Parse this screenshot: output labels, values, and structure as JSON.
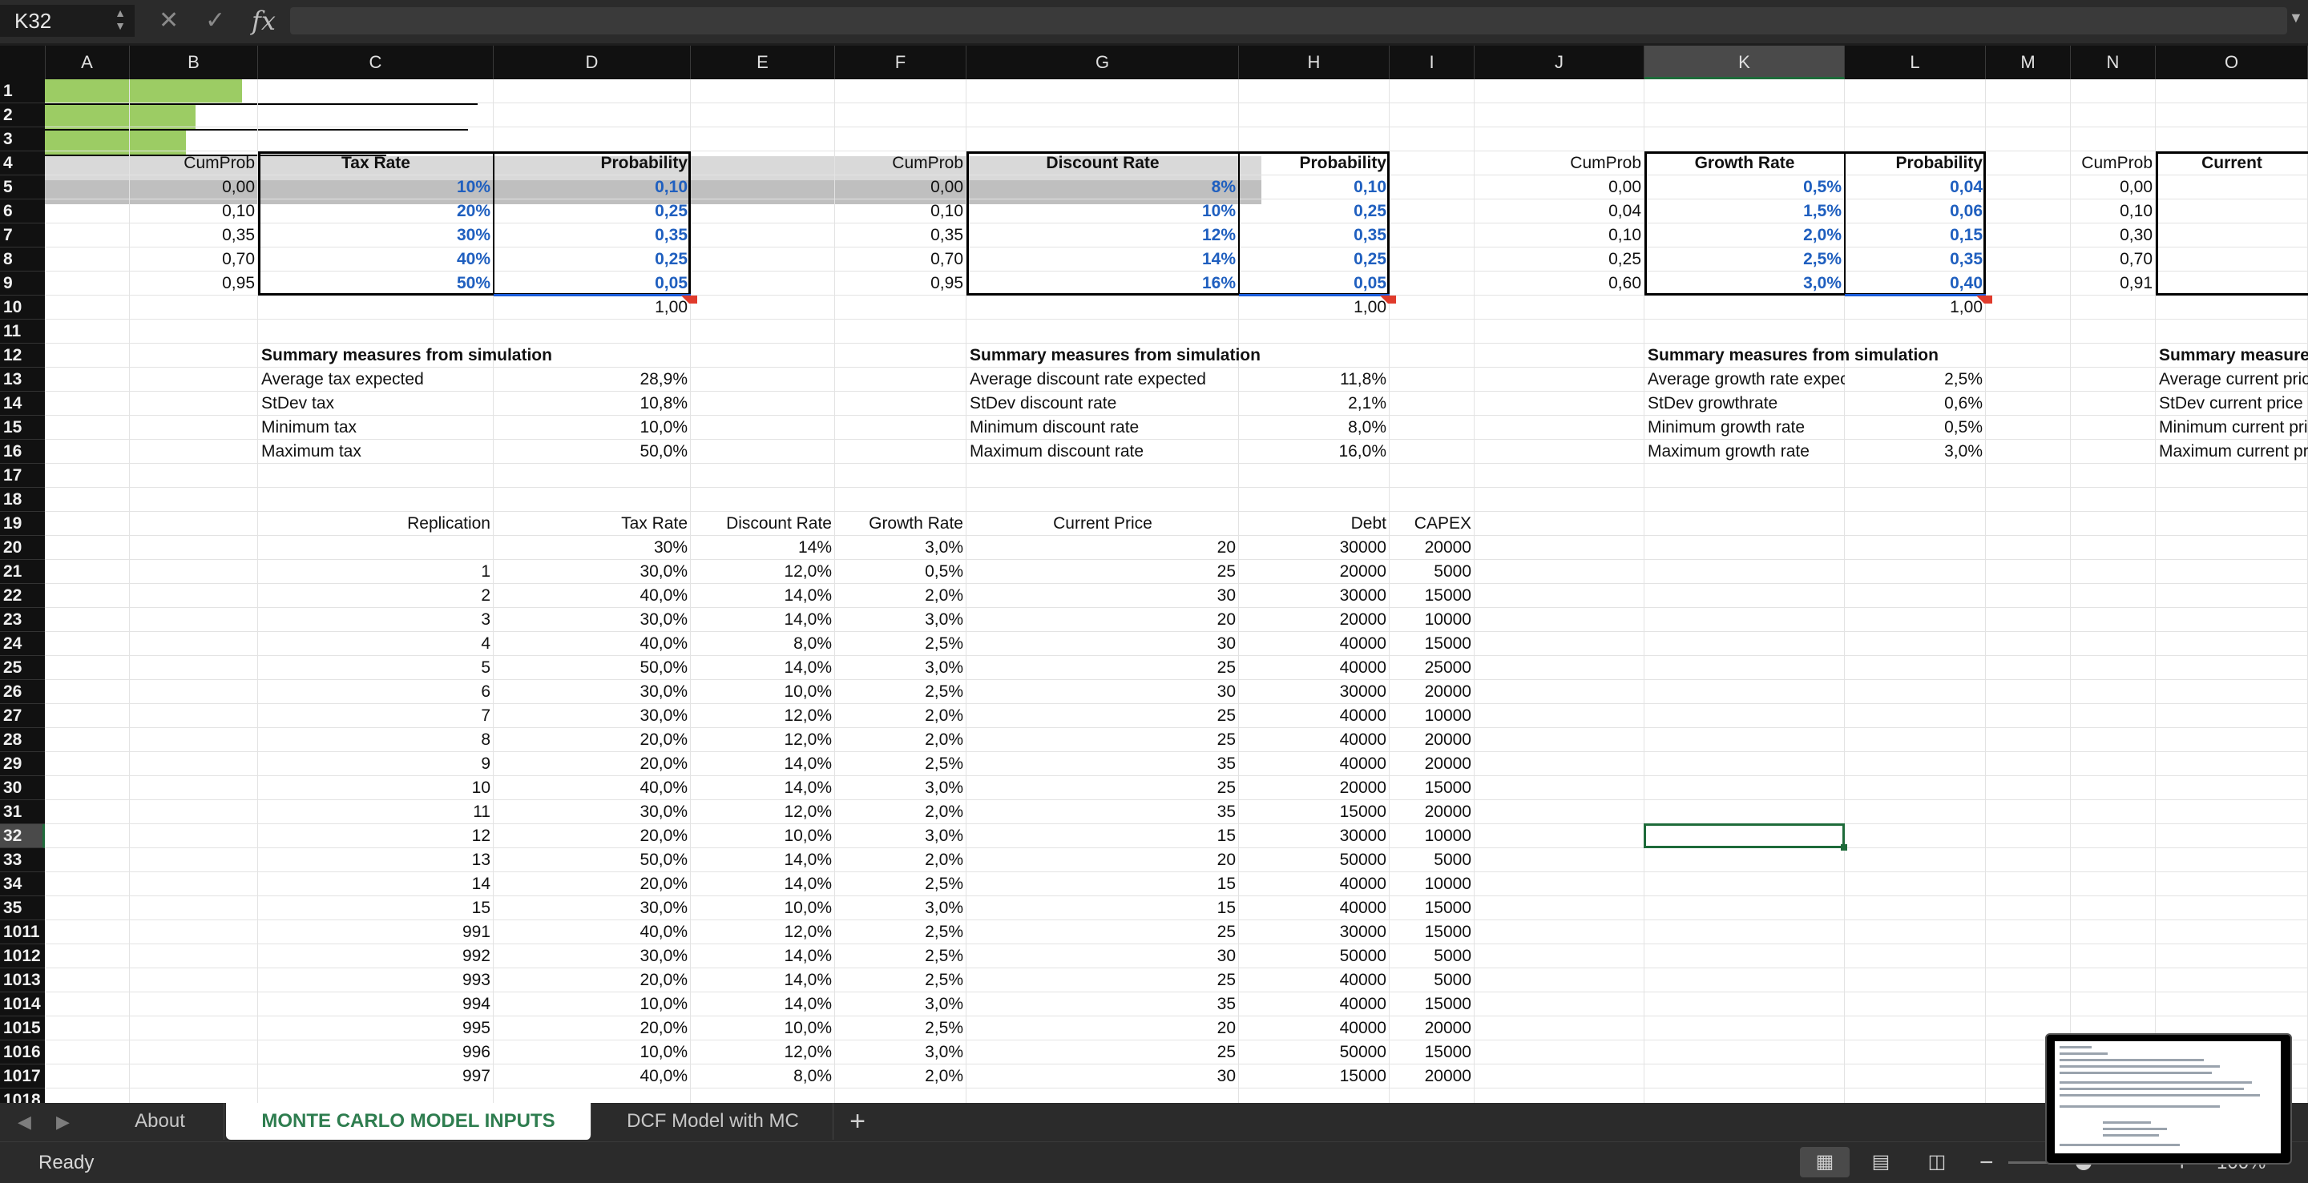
{
  "formula_bar": {
    "cell_ref": "K32",
    "formula": ""
  },
  "columns": [
    "A",
    "B",
    "C",
    "D",
    "E",
    "F",
    "G",
    "H",
    "I",
    "J",
    "K",
    "L",
    "M",
    "N",
    "O"
  ],
  "rows": [
    "1",
    "2",
    "3",
    "4",
    "5",
    "6",
    "7",
    "8",
    "9",
    "10",
    "11",
    "12",
    "13",
    "14",
    "15",
    "16",
    "17",
    "18",
    "19",
    "20",
    "21",
    "22",
    "23",
    "24",
    "25",
    "26",
    "27",
    "28",
    "29",
    "30",
    "31",
    "32",
    "33",
    "34",
    "35",
    "1011",
    "1012",
    "1013",
    "1014",
    "1015",
    "1016",
    "1017",
    "1018"
  ],
  "selected": {
    "column": "K",
    "row": "32"
  },
  "tax_table": {
    "headers": [
      "CumProb",
      "Tax Rate",
      "Probability"
    ],
    "cumprob": [
      "0,00",
      "0,10",
      "0,35",
      "0,70",
      "0,95"
    ],
    "rates": [
      "10%",
      "20%",
      "30%",
      "40%",
      "50%"
    ],
    "probs": [
      "0,10",
      "0,25",
      "0,35",
      "0,25",
      "0,05"
    ],
    "total": "1,00"
  },
  "discount_table": {
    "headers": [
      "CumProb",
      "Discount Rate",
      "Probability"
    ],
    "cumprob": [
      "0,00",
      "0,10",
      "0,35",
      "0,70",
      "0,95"
    ],
    "rates": [
      "8%",
      "10%",
      "12%",
      "14%",
      "16%"
    ],
    "probs": [
      "0,10",
      "0,25",
      "0,35",
      "0,25",
      "0,05"
    ],
    "total": "1,00"
  },
  "growth_table": {
    "headers": [
      "CumProb",
      "Growth Rate",
      "Probability"
    ],
    "cumprob": [
      "0,00",
      "0,04",
      "0,10",
      "0,25",
      "0,60"
    ],
    "rates": [
      "0,5%",
      "1,5%",
      "2,0%",
      "2,5%",
      "3,0%"
    ],
    "probs": [
      "0,04",
      "0,06",
      "0,15",
      "0,35",
      "0,40"
    ],
    "total": "1,00"
  },
  "price_table": {
    "headers": [
      "CumProb",
      "Current"
    ],
    "cumprob": [
      "0,00",
      "0,10",
      "0,30",
      "0,70",
      "0,91"
    ]
  },
  "summary_tax": {
    "title": "Summary measures from simulation",
    "labels": [
      "Average tax expected",
      "StDev tax",
      "Minimum tax",
      "Maximum tax"
    ],
    "values": [
      "28,9%",
      "10,8%",
      "10,0%",
      "50,0%"
    ]
  },
  "summary_discount": {
    "title": "Summary measures from simulation",
    "labels": [
      "Average discount rate expected",
      "StDev discount rate",
      "Minimum discount rate",
      "Maximum discount rate"
    ],
    "values": [
      "11,8%",
      "2,1%",
      "8,0%",
      "16,0%"
    ]
  },
  "summary_growth": {
    "title": "Summary measures from simulation",
    "labels": [
      "Average growth rate expected",
      "StDev growthrate",
      "Minimum growth rate",
      "Maximum growth rate"
    ],
    "values": [
      "2,5%",
      "0,6%",
      "0,5%",
      "3,0%"
    ]
  },
  "summary_price": {
    "title": "Summary measures",
    "labels": [
      "Average current pric",
      "StDev current price",
      "Minimum current pric",
      "Maximum current pri"
    ]
  },
  "replication": {
    "headers": [
      "Replication",
      "Tax Rate",
      "Discount Rate",
      "Growth Rate",
      "Current Price",
      "Debt",
      "CAPEX"
    ],
    "base": [
      "",
      "30%",
      "14%",
      "3,0%",
      "20",
      "30000",
      "20000"
    ],
    "rows": [
      [
        "1",
        "30,0%",
        "12,0%",
        "0,5%",
        "25",
        "20000",
        "5000"
      ],
      [
        "2",
        "40,0%",
        "14,0%",
        "2,0%",
        "30",
        "30000",
        "15000"
      ],
      [
        "3",
        "30,0%",
        "14,0%",
        "3,0%",
        "20",
        "20000",
        "10000"
      ],
      [
        "4",
        "40,0%",
        "8,0%",
        "2,5%",
        "30",
        "40000",
        "15000"
      ],
      [
        "5",
        "50,0%",
        "14,0%",
        "3,0%",
        "25",
        "40000",
        "25000"
      ],
      [
        "6",
        "30,0%",
        "10,0%",
        "2,5%",
        "30",
        "30000",
        "20000"
      ],
      [
        "7",
        "30,0%",
        "12,0%",
        "2,0%",
        "25",
        "40000",
        "10000"
      ],
      [
        "8",
        "20,0%",
        "12,0%",
        "2,0%",
        "25",
        "40000",
        "20000"
      ],
      [
        "9",
        "20,0%",
        "14,0%",
        "2,5%",
        "35",
        "40000",
        "20000"
      ],
      [
        "10",
        "40,0%",
        "14,0%",
        "3,0%",
        "25",
        "20000",
        "15000"
      ],
      [
        "11",
        "30,0%",
        "12,0%",
        "2,0%",
        "35",
        "15000",
        "20000"
      ],
      [
        "12",
        "20,0%",
        "10,0%",
        "3,0%",
        "15",
        "30000",
        "10000"
      ],
      [
        "13",
        "50,0%",
        "14,0%",
        "2,0%",
        "20",
        "50000",
        "5000"
      ],
      [
        "14",
        "20,0%",
        "14,0%",
        "2,5%",
        "15",
        "40000",
        "10000"
      ],
      [
        "15",
        "30,0%",
        "10,0%",
        "3,0%",
        "15",
        "40000",
        "15000"
      ],
      [
        "991",
        "40,0%",
        "12,0%",
        "2,5%",
        "25",
        "30000",
        "15000"
      ],
      [
        "992",
        "30,0%",
        "14,0%",
        "2,5%",
        "30",
        "50000",
        "5000"
      ],
      [
        "993",
        "20,0%",
        "14,0%",
        "2,5%",
        "25",
        "40000",
        "5000"
      ],
      [
        "994",
        "10,0%",
        "14,0%",
        "3,0%",
        "35",
        "40000",
        "15000"
      ],
      [
        "995",
        "20,0%",
        "10,0%",
        "2,5%",
        "20",
        "40000",
        "20000"
      ],
      [
        "996",
        "10,0%",
        "12,0%",
        "3,0%",
        "25",
        "50000",
        "15000"
      ],
      [
        "997",
        "40,0%",
        "8,0%",
        "2,0%",
        "30",
        "15000",
        "20000"
      ]
    ]
  },
  "tabs": {
    "items": [
      "About",
      "MONTE CARLO MODEL INPUTS",
      "DCF Model with MC"
    ],
    "active": 1
  },
  "status": {
    "text": "Ready",
    "zoom": "100%"
  },
  "icons": {
    "cancel": "cancel-icon",
    "confirm": "check-icon",
    "fx": "function-icon",
    "add_sheet": "plus-icon",
    "prev": "arrow-left-icon",
    "next": "arrow-right-icon"
  },
  "colors": {
    "accent": "#1e6b3a",
    "input_blue": "#1f5fbf",
    "total_green": "#9ccc64"
  }
}
